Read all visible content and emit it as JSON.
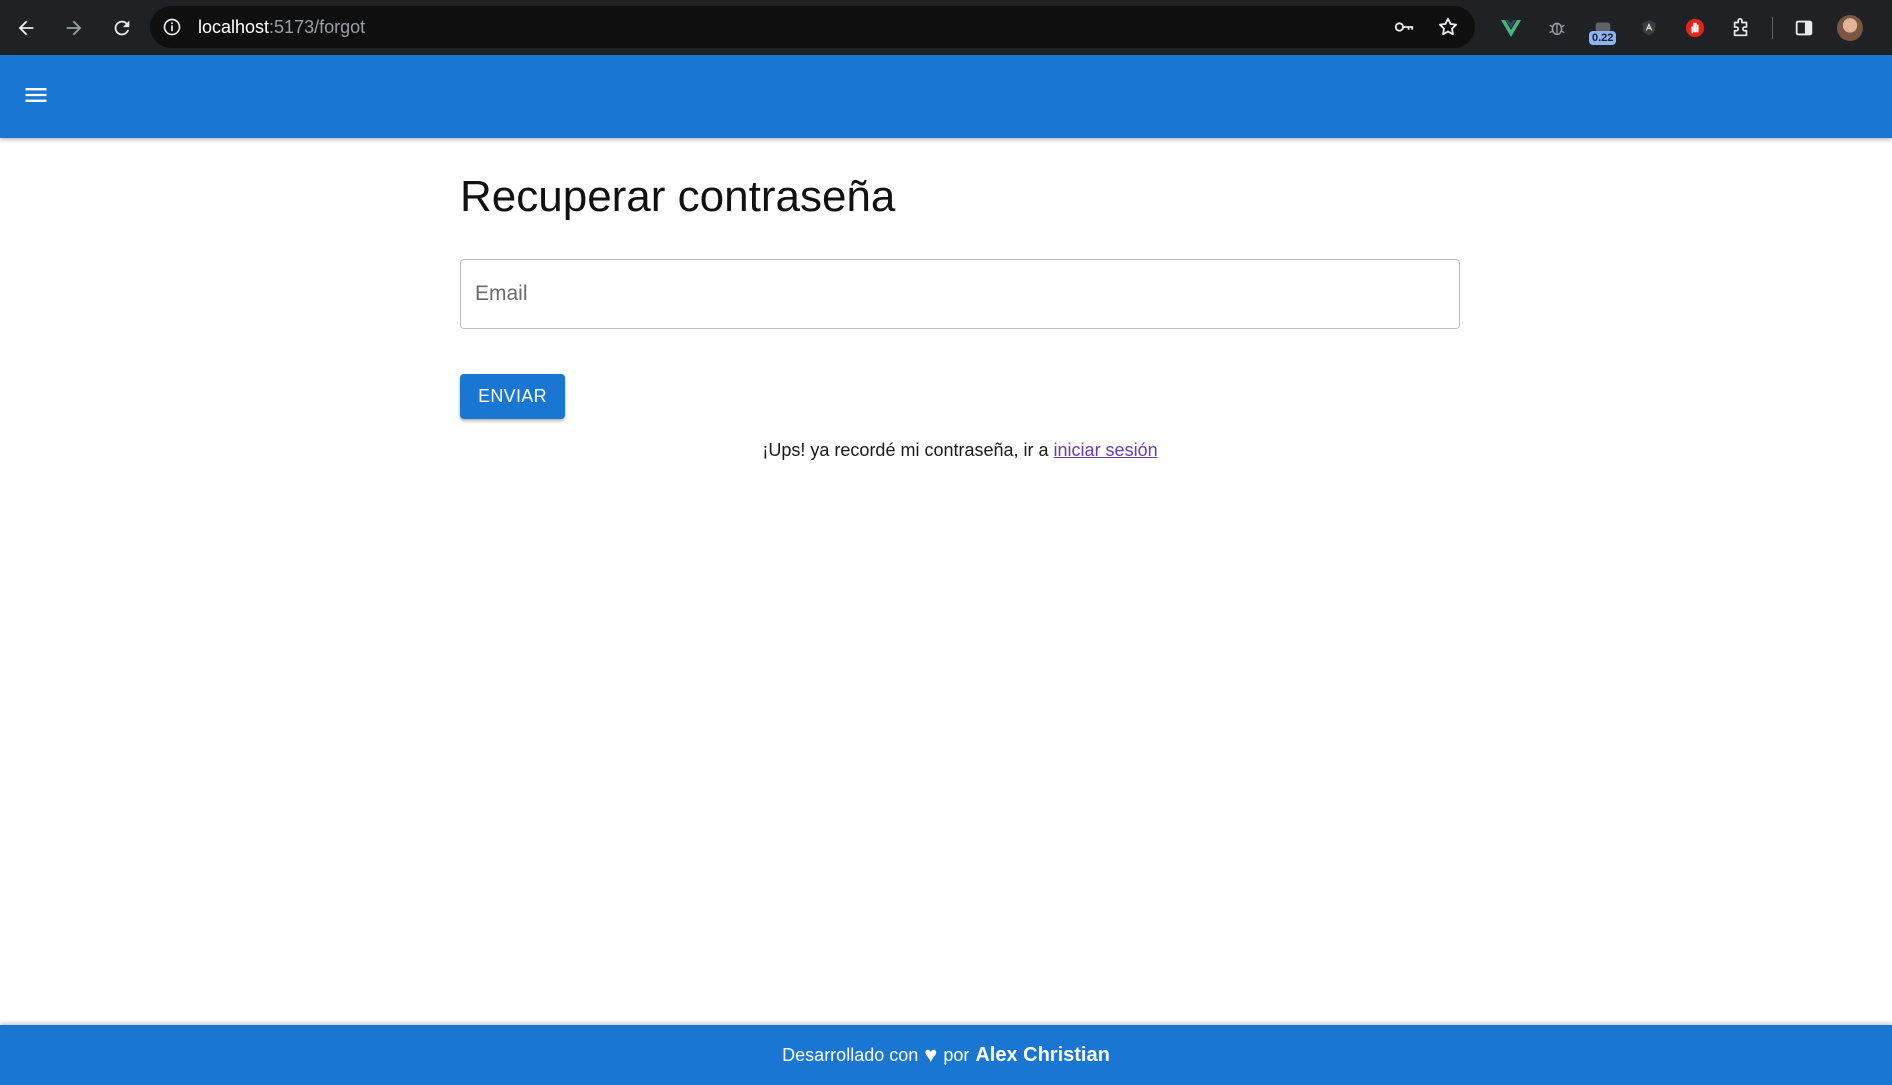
{
  "browser": {
    "url_host": "localhost",
    "url_path": ":5173/forgot",
    "extension_badge": "0.22"
  },
  "page": {
    "title": "Recuperar contraseña",
    "email_placeholder": "Email",
    "send_label": "ENVIAR",
    "hint_text": "¡Ups! ya recordé mi contraseña, ir a",
    "login_link": "iniciar sesión"
  },
  "footer": {
    "prefix": "Desarrollado con",
    "heart": "♥",
    "middle": "por",
    "author": "Alex Christian"
  },
  "colors": {
    "primary": "#1976d2",
    "chrome": "#202124",
    "link": "#6a3ab1"
  }
}
